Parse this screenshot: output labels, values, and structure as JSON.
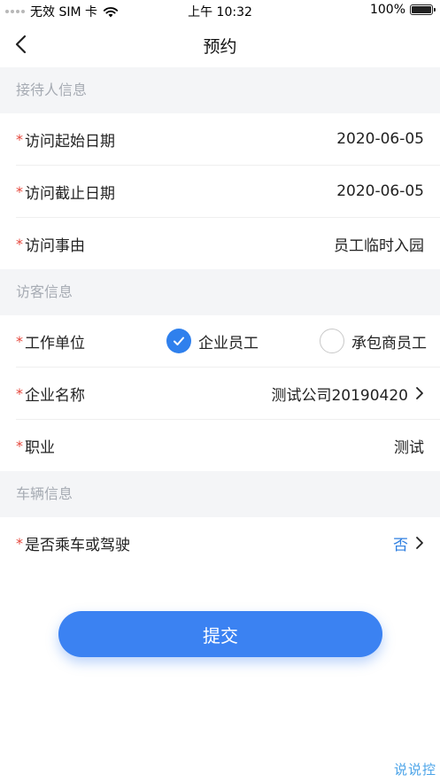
{
  "status_bar": {
    "carrier": "无效 SIM 卡",
    "time": "上午 10:32",
    "battery": "100%",
    "battery_level": 1.0
  },
  "nav": {
    "title": "预约",
    "back_icon": "chevron-left-icon"
  },
  "sections": {
    "receptionist": {
      "header": "接待人信息",
      "start_date_label": "访问起始日期",
      "start_date_value": "2020-06-05",
      "end_date_label": "访问截止日期",
      "end_date_value": "2020-06-05",
      "reason_label": "访问事由",
      "reason_value": "员工临时入园"
    },
    "visitor": {
      "header": "访客信息",
      "work_unit_label": "工作单位",
      "work_unit_options": [
        "企业员工",
        "承包商员工"
      ],
      "work_unit_selected": "企业员工",
      "company_label": "企业名称",
      "company_value": "测试公司20190420",
      "job_label": "职业",
      "job_value": "测试"
    },
    "vehicle": {
      "header": "车辆信息",
      "driving_label": "是否乘车或驾驶",
      "driving_value": "否"
    }
  },
  "required_mark": "*",
  "submit_label": "提交",
  "watermark": "说说控",
  "colors": {
    "accent": "#3b82f2",
    "required": "#e5463b",
    "section_bg": "#f4f5f7",
    "section_text": "#a6abb3",
    "value_link": "#2f7fe0"
  }
}
